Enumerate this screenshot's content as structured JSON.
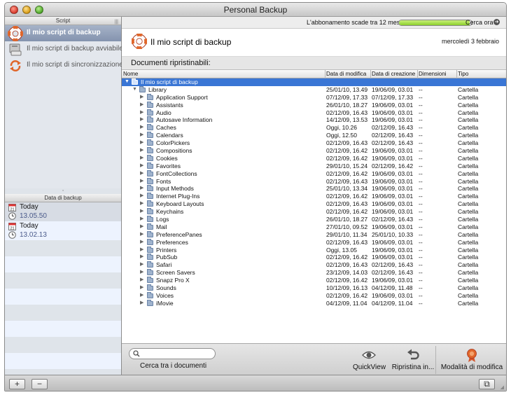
{
  "window": {
    "title": "Personal Backup"
  },
  "status": {
    "subscription_text": "L'abbonamento scade tra 12 mesi.",
    "subscription_remaining": 0.97,
    "check_label": "Cerca ora"
  },
  "sidebar": {
    "scripts_header": "Script",
    "scripts": [
      {
        "label": "Il mio script di backup",
        "icon": "lifebuoy-icon",
        "selected": true
      },
      {
        "label": "Il mio script di backup avviabile",
        "icon": "disk-drive-icon",
        "selected": false
      },
      {
        "label": "Il mio script di sincronizzazione",
        "icon": "sync-arrows-icon",
        "selected": false
      }
    ],
    "dates_header": "Data di backup",
    "dates": [
      {
        "day": "Today",
        "time": "13.05.50"
      },
      {
        "day": "Today",
        "time": "13.02.13"
      }
    ],
    "calendar_day": "21"
  },
  "header": {
    "title": "Il mio script di backup",
    "date": "mercoledì 3 febbraio",
    "docs_label": "Documenti ripristinabili:"
  },
  "table": {
    "columns": [
      "Nome",
      "Data di modifica",
      "Data di creazione",
      "Dimensioni",
      "Tipo"
    ],
    "rows": [
      {
        "name": "Il mio script di backup",
        "modified": "",
        "created": "",
        "size": "",
        "type": "",
        "level": 0,
        "selected": true,
        "expanded": true
      },
      {
        "name": "Library",
        "modified": "25/01/10, 13.49",
        "created": "19/06/09, 03.01",
        "size": "--",
        "type": "Cartella",
        "level": 1,
        "expanded": true
      },
      {
        "name": "Application Support",
        "modified": "07/12/09, 17.33",
        "created": "07/12/09, 17.33",
        "size": "--",
        "type": "Cartella",
        "level": 2
      },
      {
        "name": "Assistants",
        "modified": "26/01/10, 18.27",
        "created": "19/06/09, 03.01",
        "size": "--",
        "type": "Cartella",
        "level": 2
      },
      {
        "name": "Audio",
        "modified": "02/12/09, 16.43",
        "created": "19/06/09, 03.01",
        "size": "--",
        "type": "Cartella",
        "level": 2
      },
      {
        "name": "Autosave Information",
        "modified": "14/12/09, 13.53",
        "created": "19/06/09, 03.01",
        "size": "--",
        "type": "Cartella",
        "level": 2
      },
      {
        "name": "Caches",
        "modified": "Oggi, 10.26",
        "created": "02/12/09, 16.43",
        "size": "--",
        "type": "Cartella",
        "level": 2
      },
      {
        "name": "Calendars",
        "modified": "Oggi, 12.50",
        "created": "02/12/09, 16.43",
        "size": "--",
        "type": "Cartella",
        "level": 2
      },
      {
        "name": "ColorPickers",
        "modified": "02/12/09, 16.43",
        "created": "02/12/09, 16.43",
        "size": "--",
        "type": "Cartella",
        "level": 2
      },
      {
        "name": "Compositions",
        "modified": "02/12/09, 16.42",
        "created": "19/06/09, 03.01",
        "size": "--",
        "type": "Cartella",
        "level": 2
      },
      {
        "name": "Cookies",
        "modified": "02/12/09, 16.42",
        "created": "19/06/09, 03.01",
        "size": "--",
        "type": "Cartella",
        "level": 2
      },
      {
        "name": "Favorites",
        "modified": "29/01/10, 15.24",
        "created": "02/12/09, 16.42",
        "size": "--",
        "type": "Cartella",
        "level": 2
      },
      {
        "name": "FontCollections",
        "modified": "02/12/09, 16.42",
        "created": "19/06/09, 03.01",
        "size": "--",
        "type": "Cartella",
        "level": 2
      },
      {
        "name": "Fonts",
        "modified": "02/12/09, 16.43",
        "created": "19/06/09, 03.01",
        "size": "--",
        "type": "Cartella",
        "level": 2
      },
      {
        "name": "Input Methods",
        "modified": "25/01/10, 13.34",
        "created": "19/06/09, 03.01",
        "size": "--",
        "type": "Cartella",
        "level": 2
      },
      {
        "name": "Internet Plug-Ins",
        "modified": "02/12/09, 16.42",
        "created": "19/06/09, 03.01",
        "size": "--",
        "type": "Cartella",
        "level": 2
      },
      {
        "name": "Keyboard Layouts",
        "modified": "02/12/09, 16.43",
        "created": "19/06/09, 03.01",
        "size": "--",
        "type": "Cartella",
        "level": 2
      },
      {
        "name": "Keychains",
        "modified": "02/12/09, 16.42",
        "created": "19/06/09, 03.01",
        "size": "--",
        "type": "Cartella",
        "level": 2
      },
      {
        "name": "Logs",
        "modified": "26/01/10, 18.27",
        "created": "02/12/09, 16.43",
        "size": "--",
        "type": "Cartella",
        "level": 2
      },
      {
        "name": "Mail",
        "modified": "27/01/10, 09.52",
        "created": "19/06/09, 03.01",
        "size": "--",
        "type": "Cartella",
        "level": 2
      },
      {
        "name": "PreferencePanes",
        "modified": "29/01/10, 11.34",
        "created": "25/01/10, 10.33",
        "size": "--",
        "type": "Cartella",
        "level": 2
      },
      {
        "name": "Preferences",
        "modified": "02/12/09, 16.43",
        "created": "19/06/09, 03.01",
        "size": "--",
        "type": "Cartella",
        "level": 2
      },
      {
        "name": "Printers",
        "modified": "Oggi, 13.05",
        "created": "19/06/09, 03.01",
        "size": "--",
        "type": "Cartella",
        "level": 2
      },
      {
        "name": "PubSub",
        "modified": "02/12/09, 16.42",
        "created": "19/06/09, 03.01",
        "size": "--",
        "type": "Cartella",
        "level": 2
      },
      {
        "name": "Safari",
        "modified": "02/12/09, 16.43",
        "created": "02/12/09, 16.43",
        "size": "--",
        "type": "Cartella",
        "level": 2
      },
      {
        "name": "Screen Savers",
        "modified": "23/12/09, 14.03",
        "created": "02/12/09, 16.43",
        "size": "--",
        "type": "Cartella",
        "level": 2
      },
      {
        "name": "Snapz Pro X",
        "modified": "02/12/09, 16.42",
        "created": "19/06/09, 03.01",
        "size": "--",
        "type": "Cartella",
        "level": 2
      },
      {
        "name": "Sounds",
        "modified": "10/12/09, 16.13",
        "created": "04/12/09, 11.48",
        "size": "--",
        "type": "Cartella",
        "level": 2
      },
      {
        "name": "Voices",
        "modified": "02/12/09, 16.42",
        "created": "19/06/09, 03.01",
        "size": "--",
        "type": "Cartella",
        "level": 2
      },
      {
        "name": "iMovie",
        "modified": "04/12/09, 11.04",
        "created": "04/12/09, 11.04",
        "size": "--",
        "type": "Cartella",
        "level": 2
      }
    ]
  },
  "footer": {
    "search_placeholder": "",
    "search_caption": "Cerca tra i documenti",
    "quickview_label": "QuickView",
    "restore_label": "Ripristina in...",
    "mode_label": "Modalità di modifica"
  },
  "colors": {
    "selection": "#3a76d5",
    "sidebar_selection": "#8493ae",
    "accent_orange": "#e0662a"
  }
}
